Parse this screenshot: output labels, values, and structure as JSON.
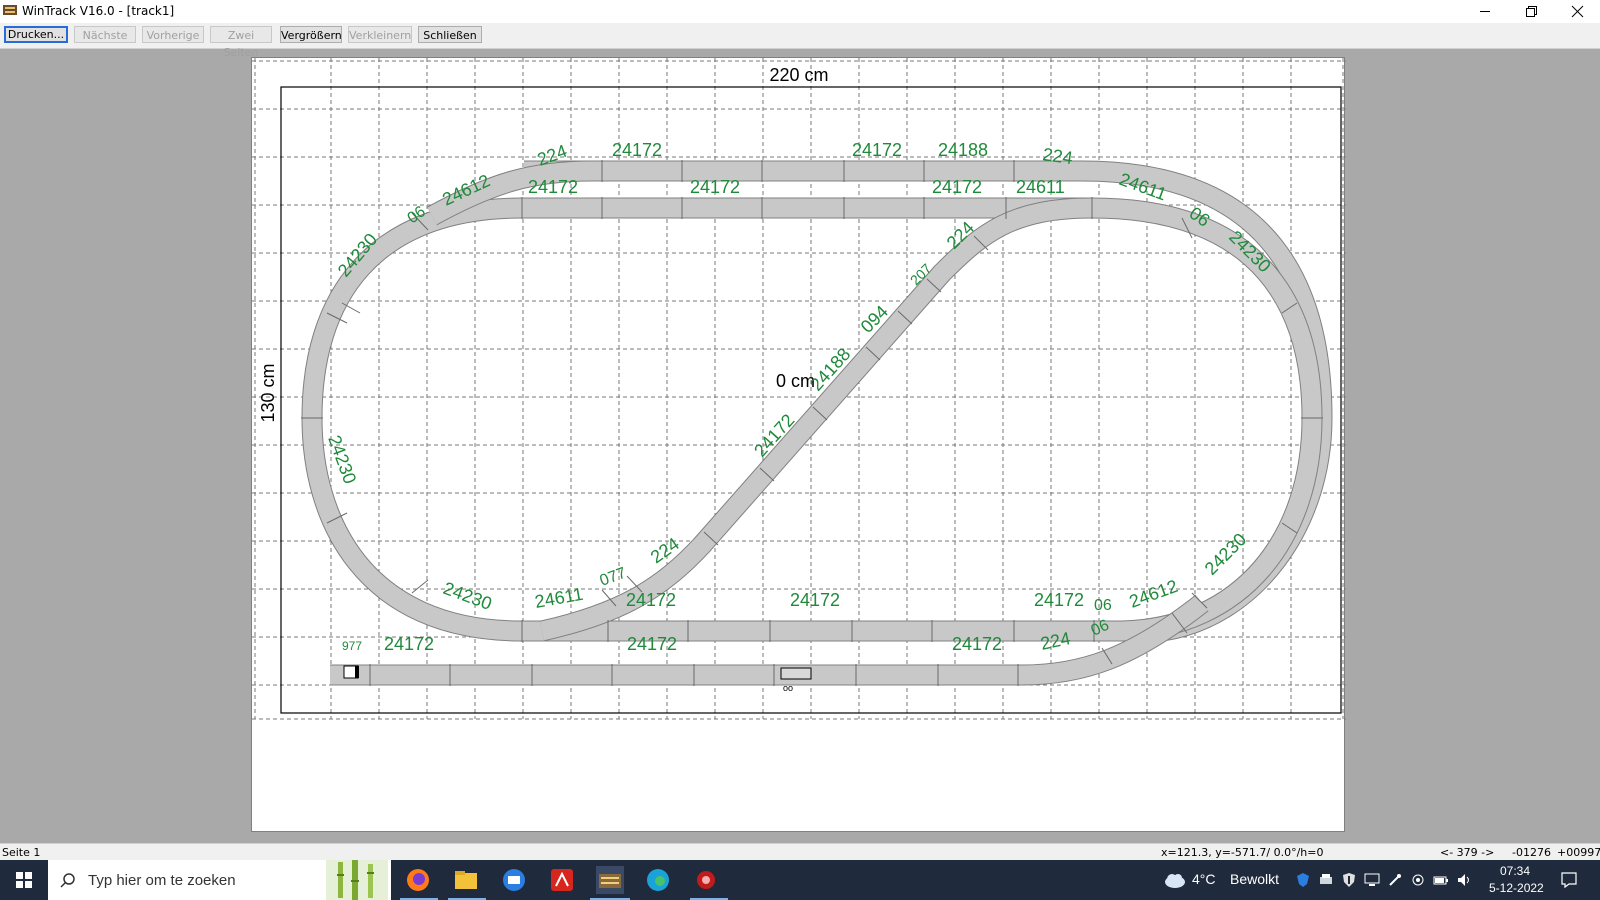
{
  "window": {
    "title": "WinTrack  V16.0 - [track1]"
  },
  "toolbar": {
    "print": "Drucken...",
    "next": "Nächste",
    "previous": "Vorherige",
    "two_pages": "Zwei Seiten",
    "zoom_in": "Vergrößern",
    "zoom_out": "Verkleinern",
    "close": "Schließen"
  },
  "plan": {
    "width_label": "220 cm",
    "height_label": "130 cm",
    "origin_label": "0 cm",
    "track_labels": {
      "outer_top_left_curve": "224",
      "outer_top_1": "24172",
      "outer_top_2": "24172",
      "outer_top_3": "24188",
      "outer_top_right_curve": "224",
      "turnout_top_right": "24611",
      "top_right_06": "06",
      "right_curve_upper": "24230",
      "right_curve_lower": "24230",
      "turnout_bottom_right": "24612",
      "bottom_right_06a": "06",
      "bottom_right_06b": "06",
      "inner_top_1": "24172",
      "inner_top_2": "24172",
      "inner_top_3": "24172",
      "inner_top_turnout": "24611",
      "top_left_turnout": "24612",
      "top_left_06": "06",
      "left_curve_upper": "24230",
      "left_curve_lower": "24230",
      "bottom_left_curve": "24230",
      "bottom_turnout": "24611",
      "bottom_077": "077",
      "bottom_straight_1": "24172",
      "bottom_straight_2": "24172",
      "bottom_straight_3": "24172",
      "diag_224_top": "224",
      "diag_207": "207",
      "diag_094": "094",
      "diag_24188": "24188",
      "diag_24172": "24172",
      "diag_224_bottom": "224",
      "siding_buffer": "977",
      "siding_1": "24172",
      "siding_2": "24172",
      "siding_3": "24172",
      "siding_curve": "224"
    }
  },
  "status": {
    "page": "Seite 1",
    "coords": "x=121.3, y=-571.7/ 0.0°/h=0",
    "nav": "<- 379 ->",
    "val1": "-01276",
    "val2": "+00997"
  },
  "taskbar": {
    "search_placeholder": "Typ hier om te zoeken",
    "weather_temp": "4°C",
    "weather_desc": "Bewolkt",
    "time": "07:34",
    "date": "5-12-2022"
  },
  "colors": {
    "label_green": "#1e8a3a",
    "track_fill": "#c8c8c8",
    "grid": "#7a7a7a",
    "taskbar": "#1f2a3c"
  },
  "icons": {
    "start": "windows-start-icon",
    "search": "search-icon",
    "firefox": "firefox-icon",
    "explorer": "file-explorer-icon",
    "mail": "mail-icon",
    "acrobat": "acrobat-icon",
    "wintrack": "wintrack-icon",
    "edge": "edge-icon",
    "redapp": "red-app-icon"
  }
}
